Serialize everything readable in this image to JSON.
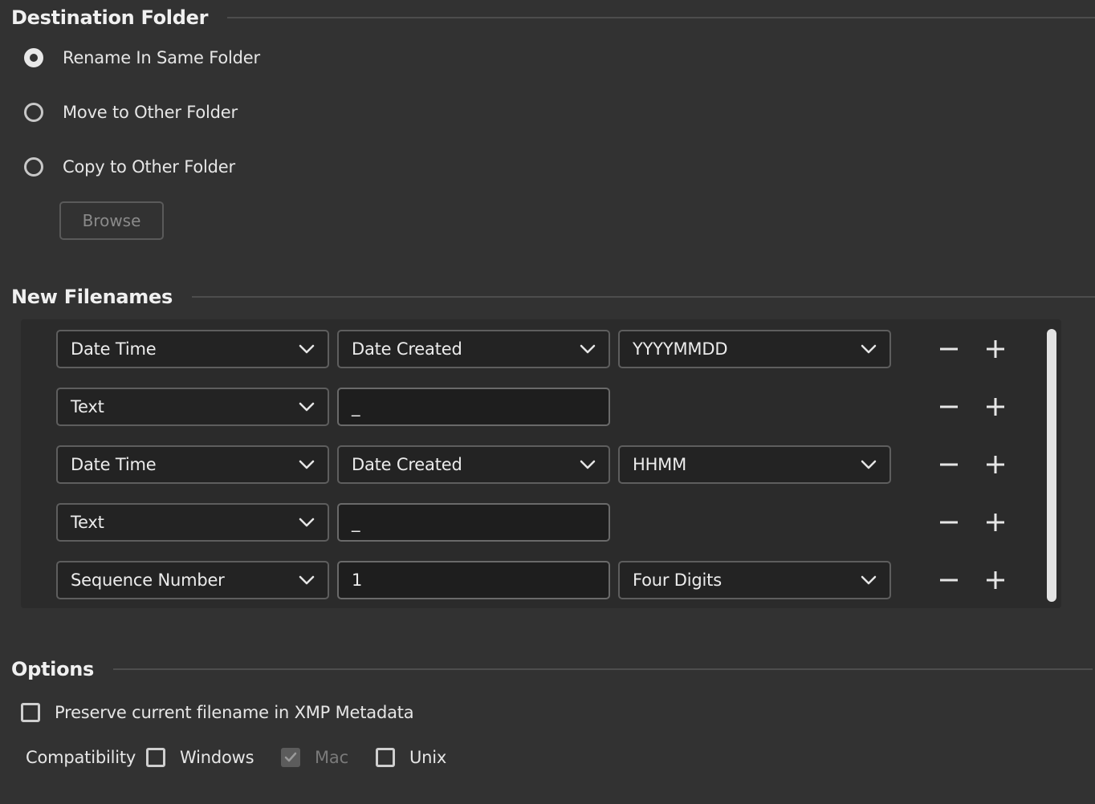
{
  "destination": {
    "title": "Destination Folder",
    "options": [
      {
        "label": "Rename In Same Folder",
        "checked": true
      },
      {
        "label": "Move to Other Folder",
        "checked": false
      },
      {
        "label": "Copy to Other Folder",
        "checked": false
      }
    ],
    "browse_label": "Browse"
  },
  "filenames": {
    "title": "New Filenames",
    "rows": [
      {
        "type": "Date Time",
        "field2": "Date Created",
        "field2_kind": "dropdown",
        "field3": "YYYYMMDD"
      },
      {
        "type": "Text",
        "field2": "_",
        "field2_kind": "text",
        "field3": ""
      },
      {
        "type": "Date Time",
        "field2": "Date Created",
        "field2_kind": "dropdown",
        "field3": "HHMM"
      },
      {
        "type": "Text",
        "field2": "_",
        "field2_kind": "text",
        "field3": ""
      },
      {
        "type": "Sequence Number",
        "field2": "1",
        "field2_kind": "text",
        "field3": "Four Digits"
      }
    ]
  },
  "options": {
    "title": "Options",
    "preserve_label": "Preserve current filename in XMP Metadata",
    "preserve_checked": false,
    "compatibility_label": "Compatibility",
    "compat": [
      {
        "label": "Windows",
        "checked": false,
        "disabled": false
      },
      {
        "label": "Mac",
        "checked": true,
        "disabled": true
      },
      {
        "label": "Unix",
        "checked": false,
        "disabled": false
      }
    ]
  },
  "colors": {
    "background": "#323232",
    "panel": "#2b2b2b",
    "field": "#232323",
    "text": "#e6e6e6"
  }
}
